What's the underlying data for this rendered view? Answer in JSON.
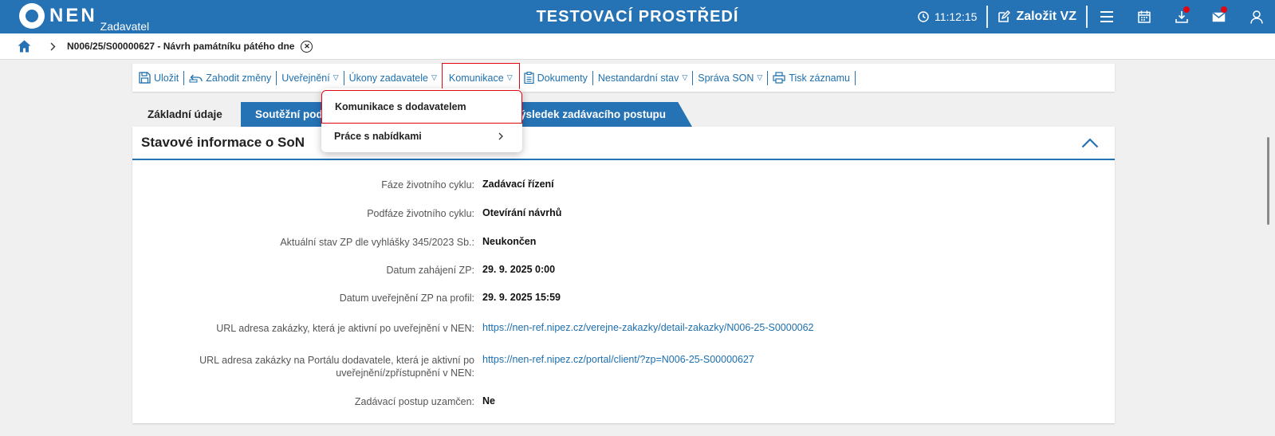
{
  "header": {
    "logo_text": "NEN",
    "logo_sub": "Zadavatel",
    "env_title": "TESTOVACÍ PROSTŘEDÍ",
    "time": "11:12:15",
    "create_label": "Založit VZ",
    "accent": "#2572b4",
    "notification_color": "#e30613"
  },
  "breadcrumb": {
    "record": "N006/25/S00000627 - Návrh památníku pátého dne"
  },
  "toolbar": {
    "save": "Uložit",
    "discard": "Zahodit změny",
    "publish": "Uveřejnění",
    "actions": "Úkony zadavatele",
    "communication": "Komunikace",
    "documents": "Dokumenty",
    "nonstandard": "Nestandardní stav",
    "son_admin": "Správa SON",
    "print": "Tisk záznamu"
  },
  "dropdown": {
    "item1": "Komunikace s dodavatelem",
    "item2": "Práce s nabídkami"
  },
  "tabs": {
    "basic": "Základní údaje",
    "competition": "Soutěžní podm",
    "result": "ýsledek zadávacího postupu"
  },
  "section": {
    "title": "Stavové informace o SoN",
    "rows": [
      {
        "label": "Fáze životního cyklu:",
        "value": "Zadávací řízení"
      },
      {
        "label": "Podfáze životního cyklu:",
        "value": "Otevírání návrhů"
      },
      {
        "label": "Aktuální stav ZP dle vyhlášky 345/2023 Sb.:",
        "value": "Neukončen"
      },
      {
        "label": "Datum zahájení ZP:",
        "value": "29. 9. 2025 0:00"
      },
      {
        "label": "Datum uveřejnění ZP na profil:",
        "value": "29. 9. 2025 15:59"
      },
      {
        "label": "URL adresa zakázky, která je aktivní po uveřejnění v NEN:",
        "value": "https://nen-ref.nipez.cz/verejne-zakazky/detail-zakazky/N006-25-S0000062"
      },
      {
        "label": "URL adresa zakázky na Portálu dodavatele, která je aktivní po uveřejnění/zpřístupnění v NEN:",
        "value": "https://nen-ref.nipez.cz/portal/client/?zp=N006-25-S00000627"
      },
      {
        "label": "Zadávací postup uzamčen:",
        "value": "Ne"
      }
    ]
  }
}
